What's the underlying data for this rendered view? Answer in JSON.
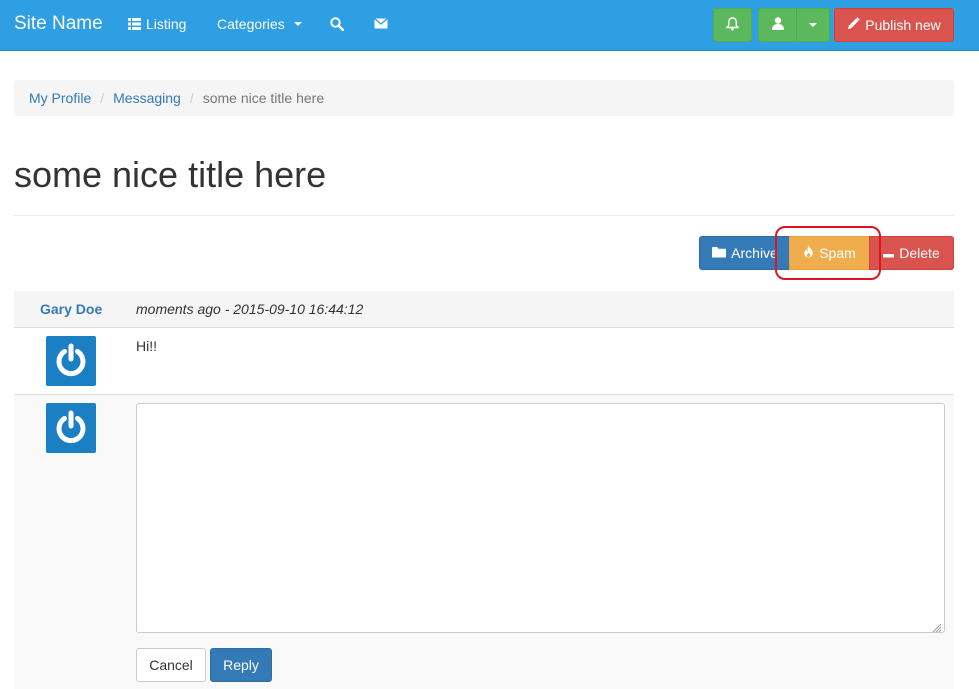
{
  "navbar": {
    "brand": "Site Name",
    "listing_label": "Listing",
    "categories_label": "Categories",
    "publish_label": "Publish new",
    "icons": [
      "list-icon",
      "search-icon",
      "envelope-icon",
      "bell-icon",
      "user-icon",
      "pencil-icon"
    ]
  },
  "breadcrumb": {
    "items": [
      "My Profile",
      "Messaging"
    ],
    "active": "some nice title here"
  },
  "page": {
    "title": "some nice title here"
  },
  "actions": {
    "archive_label": "Archive",
    "spam_label": "Spam",
    "delete_label": "Delete"
  },
  "message": {
    "author": "Gary Doe",
    "timestamp": "moments ago - 2015-09-10 16:44:12",
    "body": "Hi!!"
  },
  "reply": {
    "textarea_value": "",
    "cancel_label": "Cancel",
    "reply_label": "Reply"
  },
  "colors": {
    "navbar": "#2e9fe3",
    "primary": "#337ab7",
    "success": "#5cb85c",
    "warning": "#f0ad4e",
    "danger": "#d9534f",
    "highlight": "#e0141e"
  }
}
